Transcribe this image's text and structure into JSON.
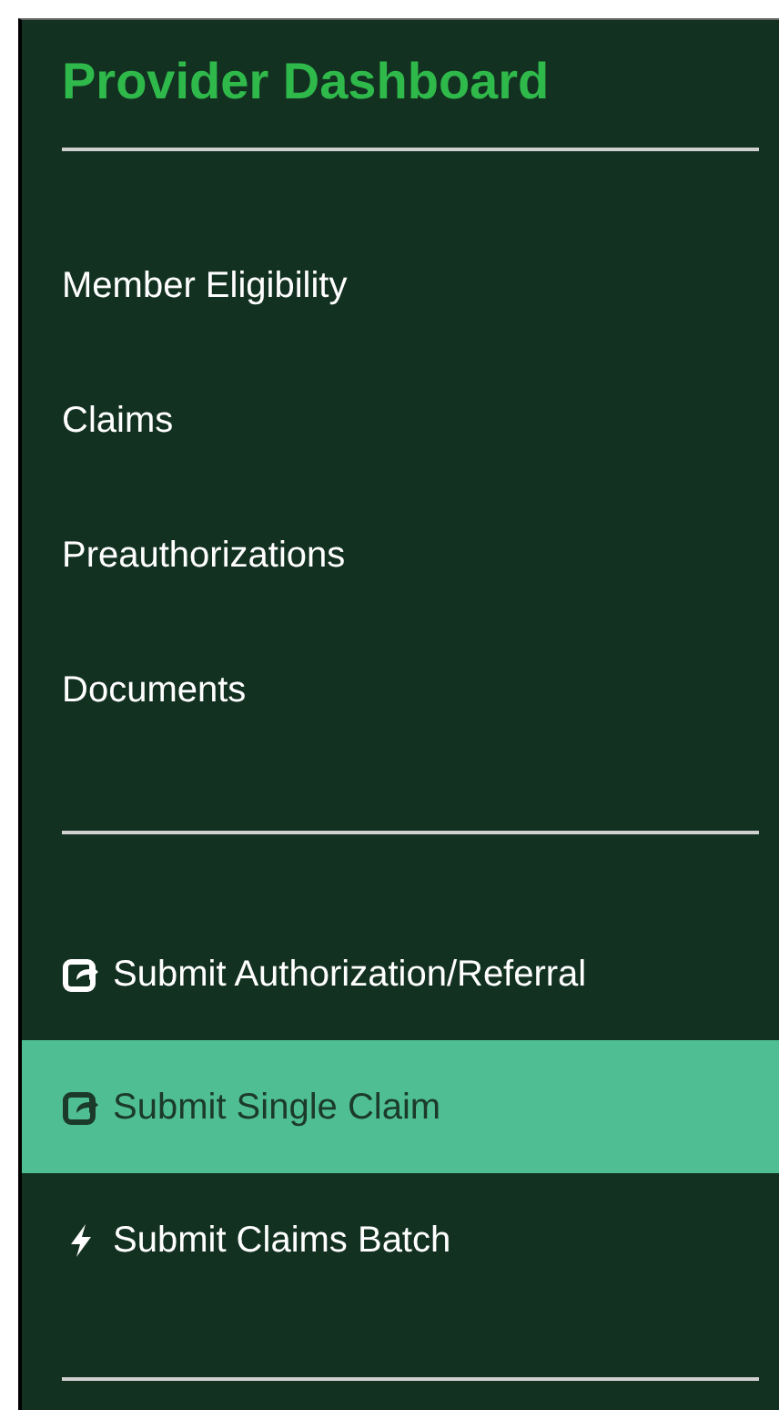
{
  "title": "Provider Dashboard",
  "nav_items": [
    {
      "label": "Member Eligibility"
    },
    {
      "label": "Claims"
    },
    {
      "label": "Preauthorizations"
    },
    {
      "label": "Documents"
    }
  ],
  "action_items": [
    {
      "label": "Submit Authorization/Referral",
      "kind": "share",
      "selected": false
    },
    {
      "label": "Submit Single Claim",
      "kind": "share",
      "selected": true
    },
    {
      "label": "Submit Claims Batch",
      "kind": "bolt",
      "selected": false
    }
  ]
}
